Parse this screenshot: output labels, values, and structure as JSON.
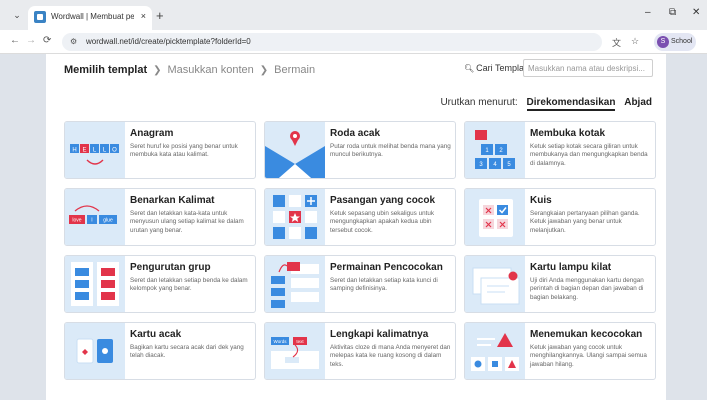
{
  "browser": {
    "tab_title": "Wordwall | Membuat pelajaran",
    "tab_close": "×",
    "new_tab": "+",
    "url": "wordwall.net/id/create/picktemplate?folderId=0",
    "profile_initial": "S",
    "profile_name": "School",
    "win_minimize": "–",
    "win_restore": "⧉",
    "win_close": "✕"
  },
  "steps": {
    "step1": "Memilih templat",
    "step2": "Masukkan konten",
    "step3": "Bermain",
    "arrow": "❯"
  },
  "search": {
    "label": "Cari Templat:",
    "placeholder": "Masukkan nama atau deskripsi..."
  },
  "sort": {
    "label": "Urutkan menurut:",
    "option_recommended": "Direkomendasikan",
    "option_alpha": "Abjad"
  },
  "templates": [
    {
      "title": "Anagram",
      "desc": "Seret huruf ke posisi yang benar untuk membuka kata atau kalimat."
    },
    {
      "title": "Roda acak",
      "desc": "Putar roda untuk melihat benda mana yang muncul berikutnya."
    },
    {
      "title": "Membuka kotak",
      "desc": "Ketuk setiap kotak secara giliran untuk membukanya dan mengungkapkan benda di dalamnya."
    },
    {
      "title": "Benarkan Kalimat",
      "desc": "Seret dan letakkan kata-kata untuk menyusun ulang setiap kalimat ke dalam urutan yang benar."
    },
    {
      "title": "Pasangan yang cocok",
      "desc": "Ketuk sepasang ubin sekaligus untuk mengungkapkan apakah kedua ubin tersebut cocok."
    },
    {
      "title": "Kuis",
      "desc": "Serangkaian pertanyaan pilihan ganda. Ketuk jawaban yang benar untuk melanjutkan."
    },
    {
      "title": "Pengurutan grup",
      "desc": "Seret dan letakkan setiap benda ke dalam kelompok yang benar."
    },
    {
      "title": "Permainan Pencocokan",
      "desc": "Seret dan letakkan setiap kata kunci di samping definisinya."
    },
    {
      "title": "Kartu lampu kilat",
      "desc": "Uji diri Anda menggunakan kartu dengan perintah di bagian depan dan jawaban di bagian belakang."
    },
    {
      "title": "Kartu acak",
      "desc": "Bagikan kartu secara acak dari dek yang telah diacak."
    },
    {
      "title": "Lengkapi kalimatnya",
      "desc": "Aktivitas cloze di mana Anda menyeret dan melepas kata ke ruang kosong di dalam teks."
    },
    {
      "title": "Menemukan kecocokan",
      "desc": "Ketuk jawaban yang cocok untuk menghilangkannya. Ulangi sampai semua jawaban hilang."
    }
  ],
  "thumb_text": {
    "anagram_letters": [
      "H",
      "E",
      "L",
      "L",
      "O"
    ],
    "open_box_numbers": [
      "1",
      "2",
      "3",
      "4",
      "5"
    ],
    "sentence_words": [
      "love",
      "I",
      "glue"
    ],
    "cloze_words": [
      "Words",
      "text"
    ]
  },
  "colors": {
    "thumb_bg": "#dbeaf8",
    "blue": "#3a8be0",
    "red": "#e2344a",
    "pink": "#f08a9a",
    "white": "#ffffff"
  }
}
